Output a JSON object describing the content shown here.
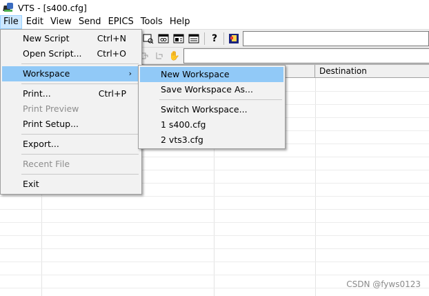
{
  "window": {
    "title": "VTS - [s400.cfg]"
  },
  "menubar": {
    "items": [
      "File",
      "Edit",
      "View",
      "Send",
      "EPICS",
      "Tools",
      "Help"
    ]
  },
  "file_menu": {
    "items": [
      {
        "label": "New Script",
        "shortcut": "Ctrl+N",
        "enabled": true
      },
      {
        "label": "Open Script...",
        "shortcut": "Ctrl+O",
        "enabled": true
      },
      {
        "label": "Workspace",
        "submenu_arrow": "›",
        "enabled": true,
        "highlighted": true
      },
      {
        "label": "Print...",
        "shortcut": "Ctrl+P",
        "enabled": true
      },
      {
        "label": "Print Preview",
        "enabled": false
      },
      {
        "label": "Print Setup...",
        "enabled": true
      },
      {
        "label": "Export...",
        "enabled": true
      },
      {
        "label": "Recent File",
        "enabled": false
      },
      {
        "label": "Exit",
        "enabled": true
      }
    ]
  },
  "workspace_menu": {
    "items": [
      {
        "label": "New Workspace",
        "highlighted": true
      },
      {
        "label": "Save Workspace As..."
      },
      {
        "label": "Switch Workspace..."
      },
      {
        "label": "1 s400.cfg"
      },
      {
        "label": "2 vts3.cfg"
      }
    ]
  },
  "grid": {
    "columns": [
      "Destination"
    ]
  },
  "toolbar": {
    "icons": [
      "print-preview-icon",
      "view-icon",
      "window-icon",
      "list-icon",
      "help-icon",
      "context-help-icon"
    ],
    "help_glyph": "?"
  },
  "toolbar2": {
    "icons": [
      "send-icon",
      "receive-icon",
      "hand-icon"
    ],
    "hand_glyph": "✋"
  },
  "watermark": {
    "text": "CSDN @fyws0123"
  },
  "colors": {
    "menu_highlight": "#91c9f7",
    "menubar_active": "#cce8ff",
    "menu_bg": "#f2f2f2"
  }
}
